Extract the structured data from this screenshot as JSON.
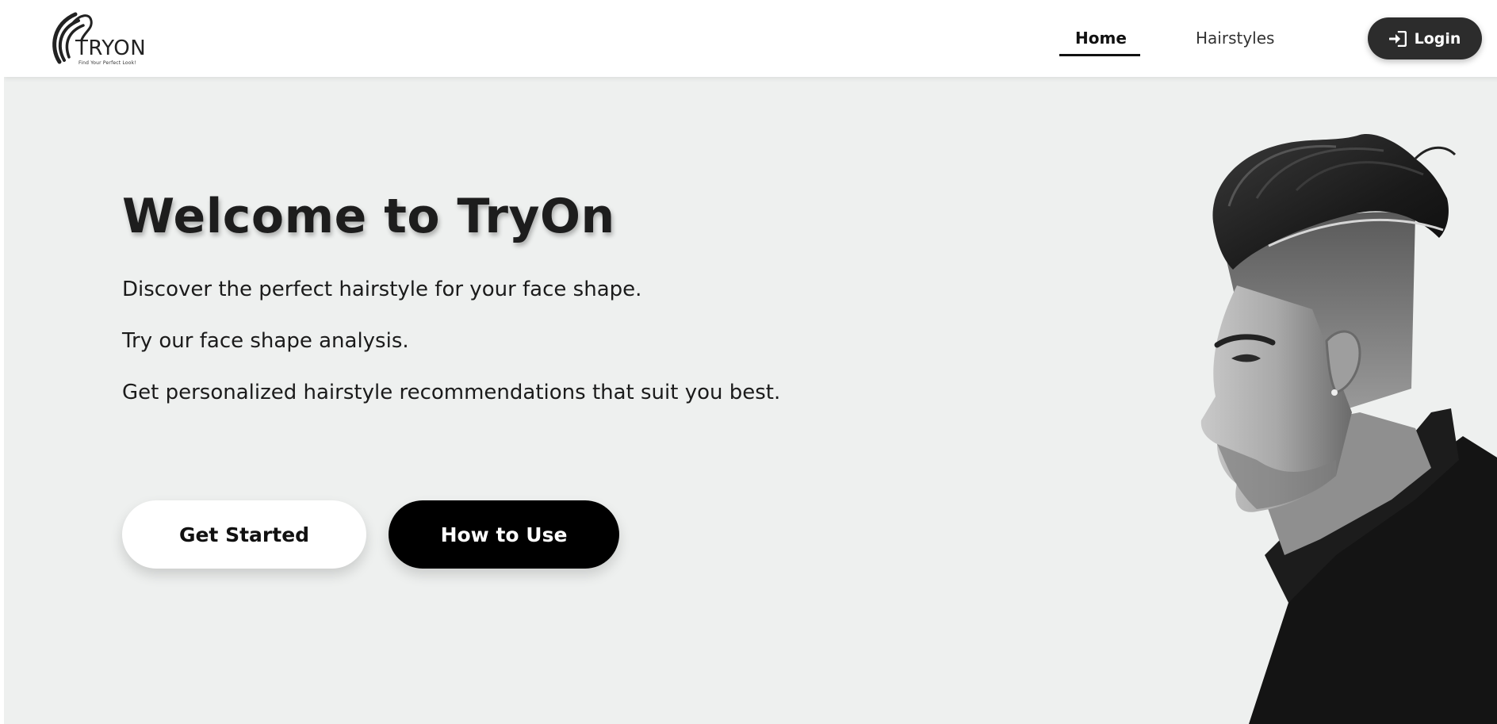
{
  "brand": {
    "name": "TRYON",
    "tagline": "Find Your Perfect Look!"
  },
  "nav": {
    "items": [
      {
        "label": "Home",
        "active": true
      },
      {
        "label": "Hairstyles",
        "active": false
      }
    ],
    "login_label": "Login",
    "login_icon": "sign-in-icon"
  },
  "hero": {
    "title": "Welcome to TryOn",
    "lines": [
      "Discover the perfect hairstyle for your face shape.",
      "Try our face shape analysis.",
      "Get personalized hairstyle recommendations that suit you best."
    ],
    "primary_button": "Get Started",
    "secondary_button": "How to Use"
  },
  "colors": {
    "background": "#eef0ef",
    "header": "#ffffff",
    "login_button": "#2c2c2c",
    "primary_button": "#ffffff",
    "secondary_button": "#000000",
    "text": "#1d1d1d"
  }
}
